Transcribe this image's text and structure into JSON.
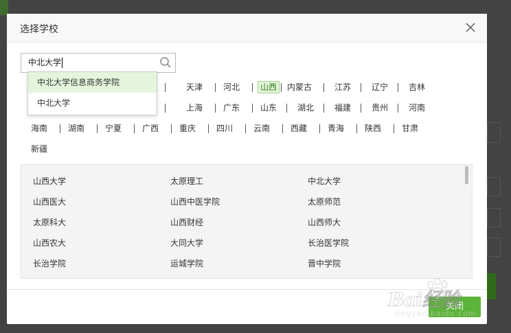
{
  "dialog": {
    "title": "选择学校",
    "close_button": "关闭"
  },
  "search": {
    "value": "中北大学",
    "suggestions": [
      "中北大学信息商务学院",
      "中北大学"
    ]
  },
  "provinces": {
    "row1": [
      "",
      "天津",
      "河北",
      "山西",
      "内蒙古",
      "江苏",
      "辽宁",
      "吉林"
    ],
    "row2": [
      "",
      "上海",
      "广东",
      "山东",
      "湖北",
      "福建",
      "贵州",
      "河南"
    ],
    "row3": [
      "海南",
      "湖南",
      "宁夏",
      "广西",
      "重庆",
      "四川",
      "云南",
      "西藏",
      "青海",
      "陕西",
      "甘肃"
    ],
    "row4": [
      "新疆"
    ],
    "selected": "山西"
  },
  "schools": [
    [
      "山西大学",
      "太原理工",
      "中北大学"
    ],
    [
      "山西医大",
      "山西中医学院",
      "太原师范"
    ],
    [
      "太原科大",
      "山西财经",
      "山西师大"
    ],
    [
      "山西农大",
      "大同大学",
      "长治医学院"
    ],
    [
      "长治学院",
      "运城学院",
      "晋中学院"
    ]
  ],
  "watermark": {
    "text": "Bai经验",
    "sub": "jingyan.baidu.com"
  },
  "colors": {
    "accent": "#5db43a",
    "selected_bg": "#e5f5dc"
  }
}
